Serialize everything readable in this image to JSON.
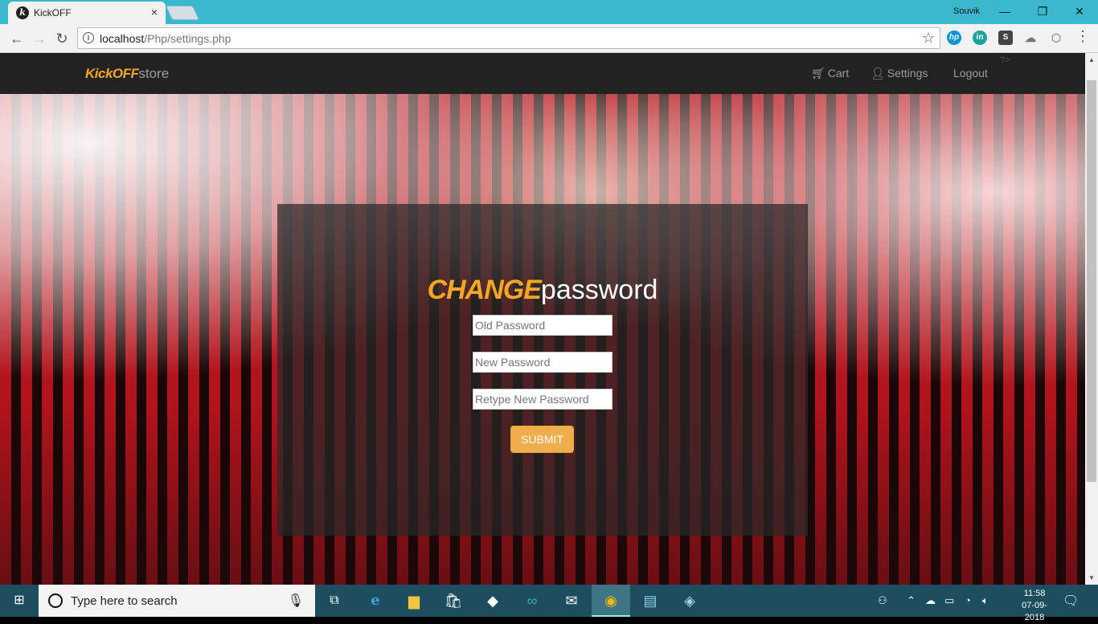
{
  "browser": {
    "tab_title": "KickOFF",
    "tab_close": "×",
    "profile_name": "Souvik",
    "window_controls": {
      "minimize": "—",
      "restore": "❐",
      "close": "✕"
    },
    "url_host": "localhost",
    "url_path": "/Php/settings.php",
    "nav_icons": [
      "back-arrow-icon",
      "forward-arrow-icon",
      "reload-icon"
    ],
    "extensions": [
      "hp-icon",
      "linkedin-extension-icon",
      "s-extension-icon",
      "cloud-extension-icon",
      "cube-extension-icon"
    ]
  },
  "navbar": {
    "brand_strong": "KickOFF",
    "brand_light": "store",
    "links": [
      {
        "label": "Cart",
        "icon": "cart-icon"
      },
      {
        "label": "Settings",
        "icon": "user-icon"
      },
      {
        "label": "Logout"
      }
    ],
    "stray_text": "?>"
  },
  "form": {
    "title_strong": "CHANGE",
    "title_light": "password",
    "old_password_placeholder": "Old Password",
    "new_password_placeholder": "New Password",
    "retype_password_placeholder": "Retype New Password",
    "submit_label": "SUBMIT"
  },
  "taskbar": {
    "search_placeholder": "Type here to search",
    "time": "11:58",
    "date": "07-09-2018",
    "pinned": [
      "task-view-icon",
      "edge-icon",
      "file-explorer-icon",
      "store-icon",
      "dropbox-icon",
      "arduino-icon",
      "mail-icon",
      "chrome-icon",
      "notepad-icon",
      "cube-app-icon"
    ]
  },
  "colors": {
    "accent": "#f5a623",
    "navbar_bg": "#222222",
    "button_bg": "#f0ad4e",
    "titlebar_bg": "#3ab8cd",
    "taskbar_bg": "#1c4e5e"
  }
}
